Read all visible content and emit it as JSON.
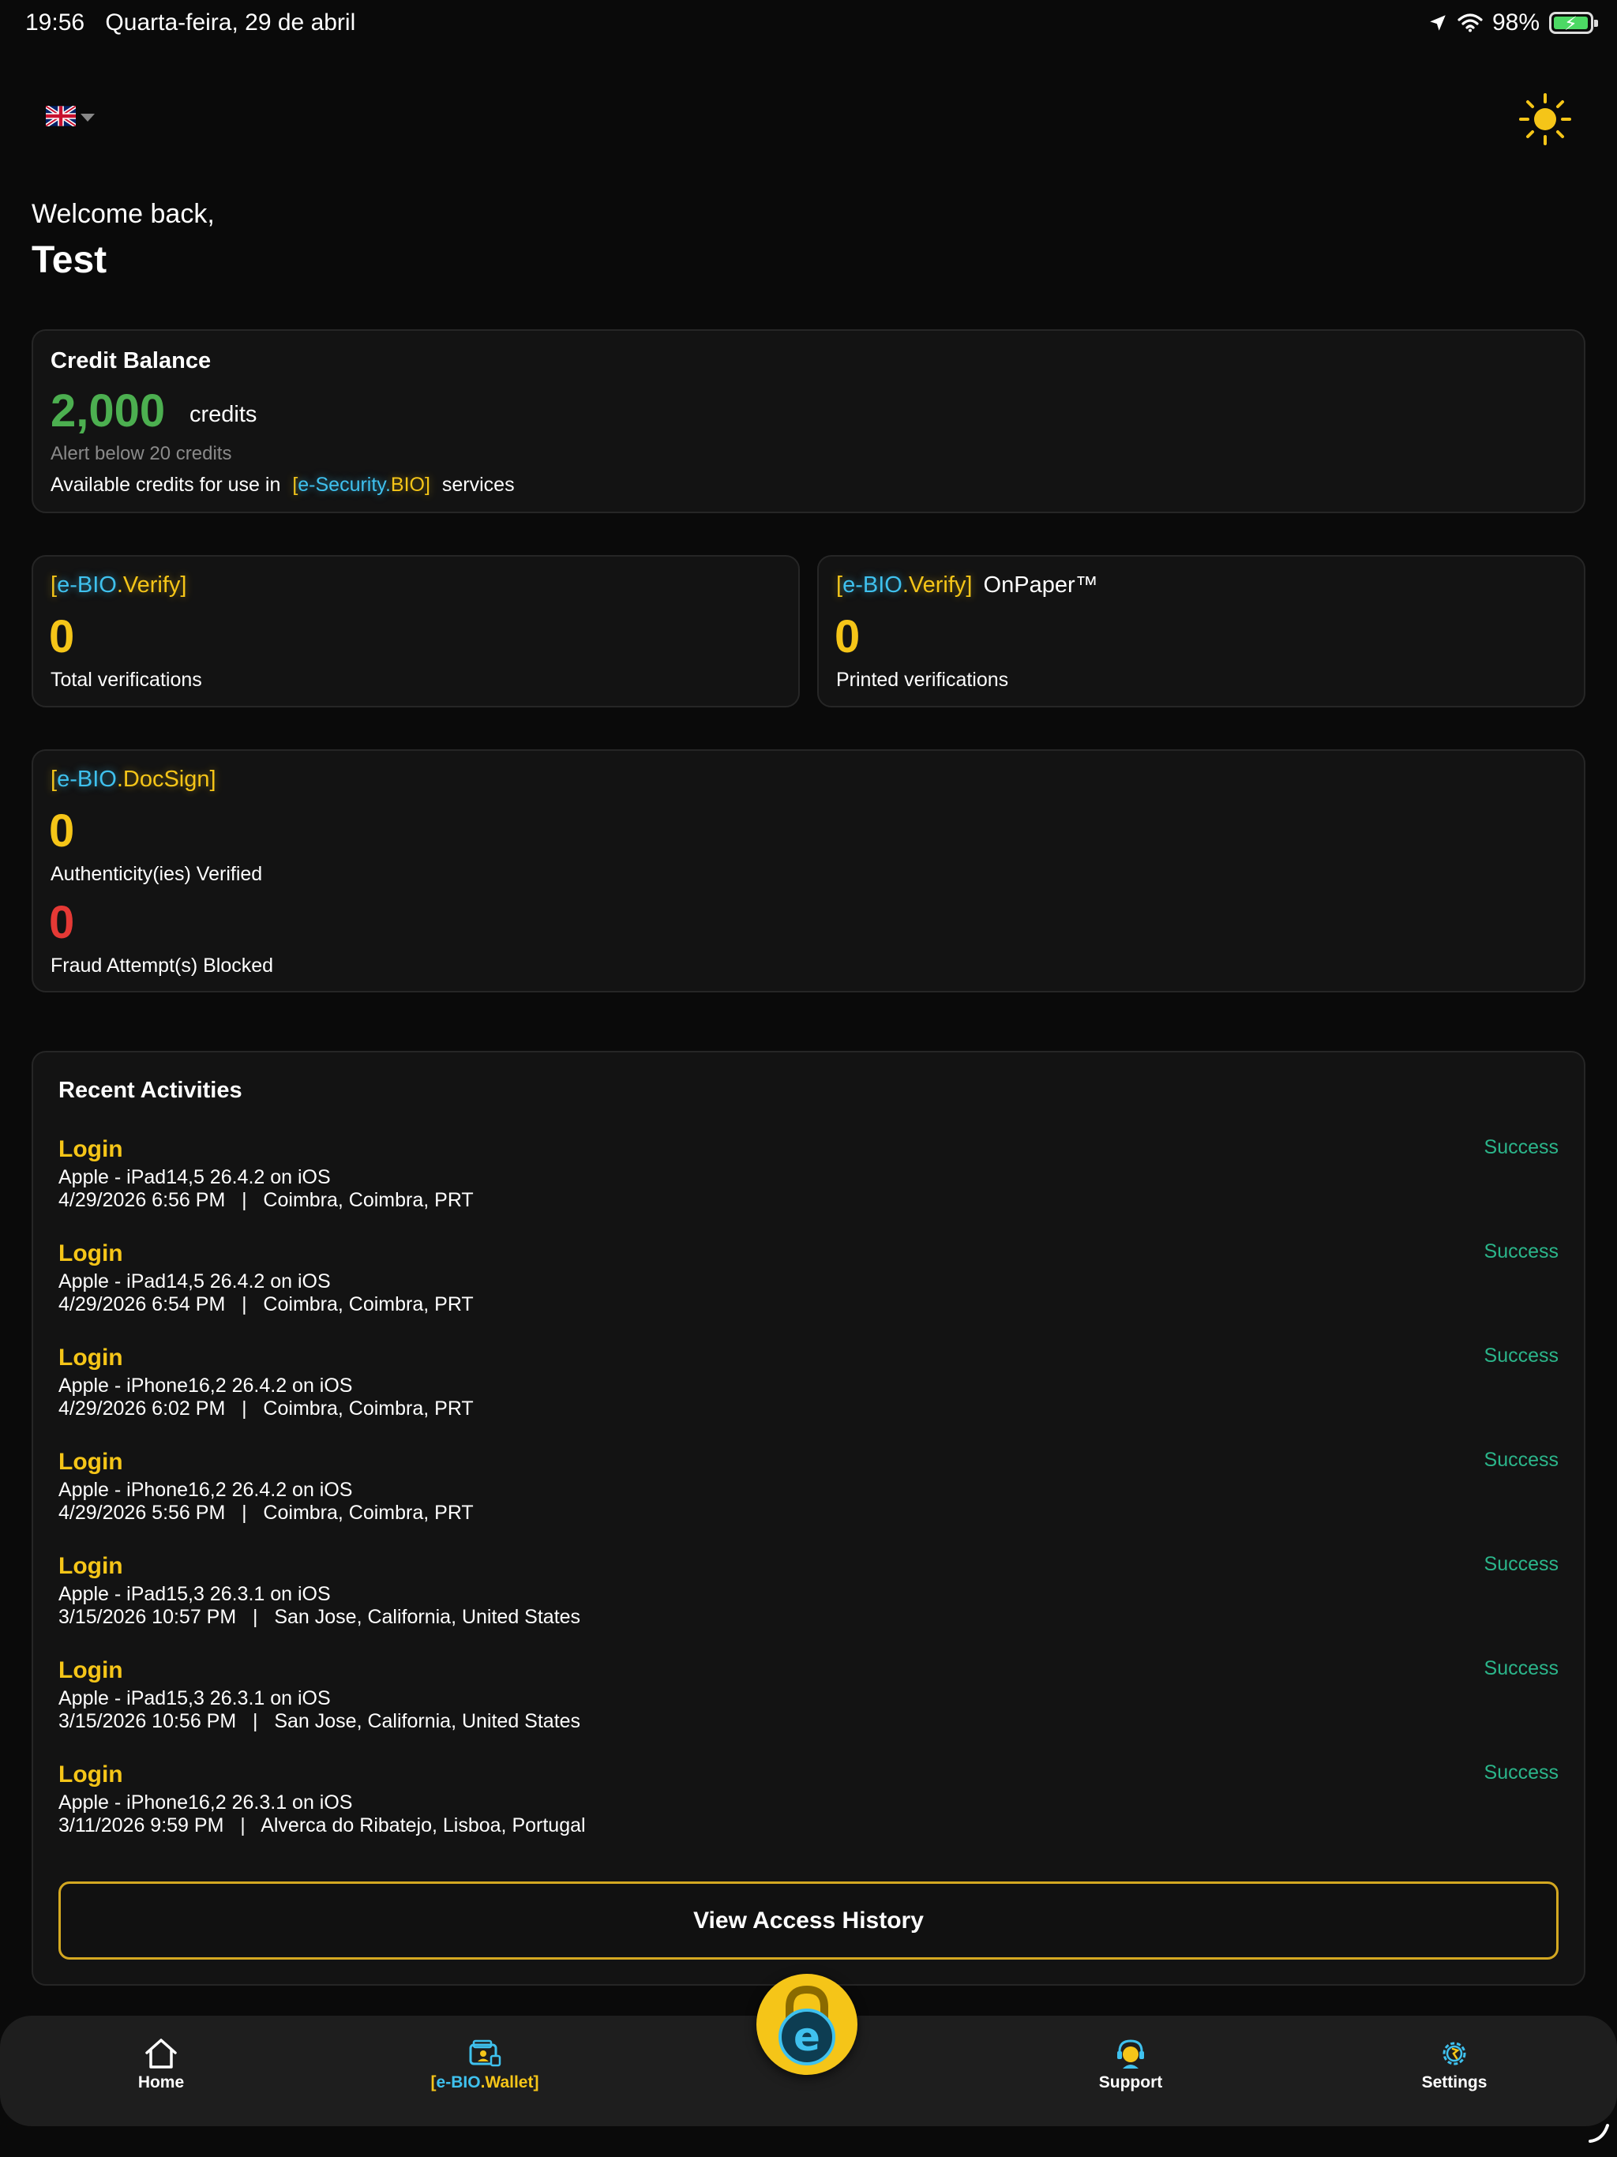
{
  "status_bar": {
    "time": "19:56",
    "date": "Quarta-feira, 29 de abril",
    "battery": "98%"
  },
  "header": {
    "language_icon": "uk-flag-icon",
    "theme_icon": "sun-icon",
    "welcome": "Welcome back,",
    "username": "Test"
  },
  "credit": {
    "title": "Credit Balance",
    "amount": "2,000",
    "unit": "credits",
    "alert": "Alert below 20 credits",
    "desc_prefix": "Available credits for use in",
    "brand_open": "[",
    "brand_e": "e-",
    "brand_security": "Security.",
    "brand_bio": "BIO",
    "brand_close": "]",
    "desc_suffix": "services"
  },
  "verify": {
    "title_open": "[",
    "title_e": "e-",
    "title_bio": "BIO",
    "title_rest": ".Verify",
    "title_close": "]",
    "count": "0",
    "label": "Total verifications"
  },
  "onpaper": {
    "title_open": "[",
    "title_e": "e-",
    "title_bio": "BIO",
    "title_rest": ".Verify",
    "title_close": "]",
    "title_suffix": "OnPaper™",
    "count": "0",
    "label": "Printed verifications"
  },
  "docsign": {
    "title_open": "[",
    "title_e": "e-",
    "title_bio": "BIO",
    "title_rest": ".DocSign",
    "title_close": "]",
    "verified_count": "0",
    "verified_label": "Authenticity(ies) Verified",
    "blocked_count": "0",
    "blocked_label": "Fraud Attempt(s) Blocked"
  },
  "activities": {
    "title": "Recent Activities",
    "items": [
      {
        "title": "Login",
        "device": "Apple - iPad14,5 26.4.2 on iOS",
        "meta": "4/29/2026 6:56 PM   |   Coimbra, Coimbra, PRT",
        "status": "Success"
      },
      {
        "title": "Login",
        "device": "Apple - iPad14,5 26.4.2 on iOS",
        "meta": "4/29/2026 6:54 PM   |   Coimbra, Coimbra, PRT",
        "status": "Success"
      },
      {
        "title": "Login",
        "device": "Apple - iPhone16,2 26.4.2 on iOS",
        "meta": "4/29/2026 6:02 PM   |   Coimbra, Coimbra, PRT",
        "status": "Success"
      },
      {
        "title": "Login",
        "device": "Apple - iPhone16,2 26.4.2 on iOS",
        "meta": "4/29/2026 5:56 PM   |   Coimbra, Coimbra, PRT",
        "status": "Success"
      },
      {
        "title": "Login",
        "device": "Apple - iPad15,3 26.3.1 on iOS",
        "meta": "3/15/2026 10:57 PM   |   San Jose, California, United States",
        "status": "Success"
      },
      {
        "title": "Login",
        "device": "Apple - iPad15,3 26.3.1 on iOS",
        "meta": "3/15/2026 10:56 PM   |   San Jose, California, United States",
        "status": "Success"
      },
      {
        "title": "Login",
        "device": "Apple - iPhone16,2 26.3.1 on iOS",
        "meta": "3/11/2026 9:59 PM   |   Alverca do Ribatejo, Lisboa, Portugal",
        "status": "Success"
      }
    ],
    "view_history": "View Access History"
  },
  "tabs": {
    "home": "Home",
    "wallet_open": "[",
    "wallet_e": "e-",
    "wallet_bio": "BIO",
    "wallet_rest": ".Wallet",
    "wallet_close": "]",
    "support": "Support",
    "settings": "Settings"
  },
  "colors": {
    "accent": "#f5c518",
    "brand_cyan": "#3fc1ee",
    "success": "#2bb58a",
    "credits": "#4caf50",
    "danger": "#e53935"
  }
}
